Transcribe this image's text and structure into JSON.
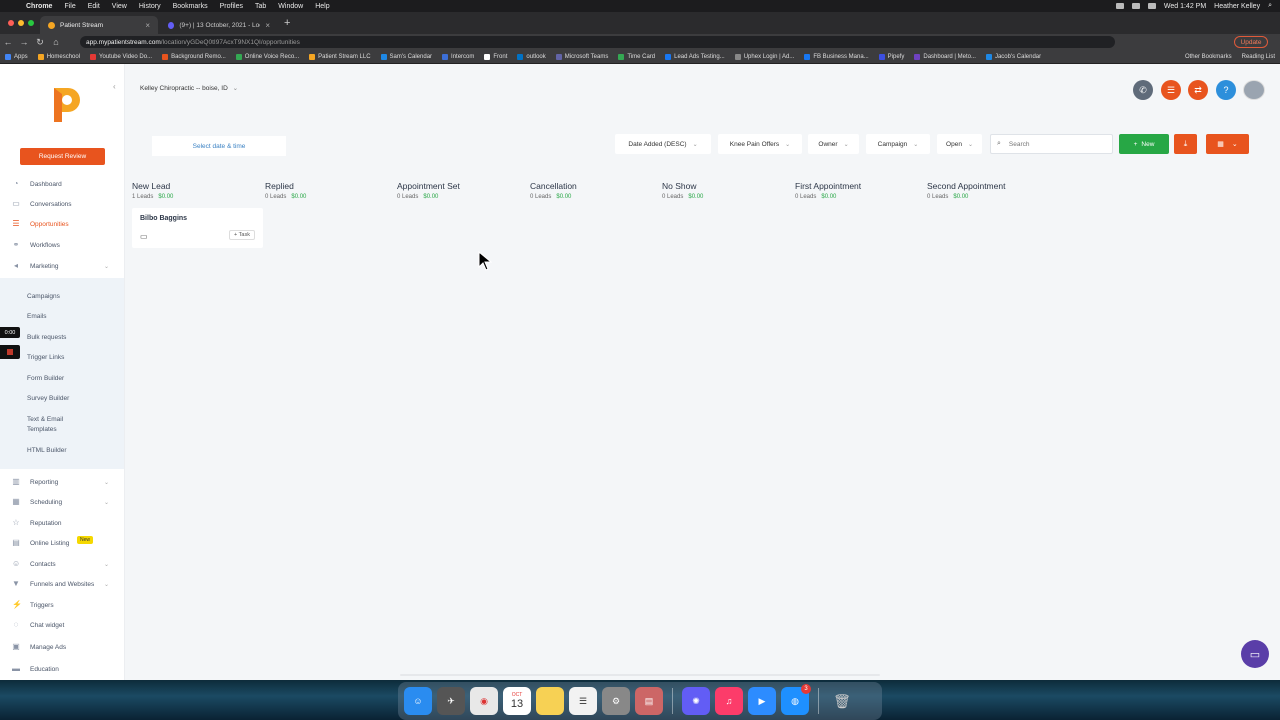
{
  "menubar": {
    "app": "Chrome",
    "items": [
      "File",
      "Edit",
      "View",
      "History",
      "Bookmarks",
      "Profiles",
      "Tab",
      "Window",
      "Help"
    ],
    "clock": "Wed 1:42 PM",
    "user": "Heather Kelley"
  },
  "browser": {
    "tabs": [
      {
        "title": "Patient Stream",
        "active": true
      },
      {
        "title": "(9+) | 13 October, 2021 - Loom",
        "active": false
      }
    ],
    "url_host": "app.mypatientstream.com",
    "url_path": "/location/yGDeQ0tI97AcxT9NX1QI/opportunities",
    "update_label": "Update",
    "bookmarks": [
      "Apps",
      "Homeschool",
      "Youtube Video Do...",
      "Background Remo...",
      "Online Voice Reco...",
      "Patient Stream LLC",
      "Sam's Calendar",
      "Intercom",
      "Front",
      "outlook",
      "Microsoft Teams",
      "Time Card",
      "Lead Ads Testing...",
      "Uphex Login | Ad...",
      "FB Business Mana...",
      "Pipefy",
      "Dashboard | Meto...",
      "Jacob's Calendar"
    ],
    "bookmarks_right": [
      "Other Bookmarks",
      "Reading List"
    ]
  },
  "sidebar": {
    "request_review": "Request Review",
    "items": [
      {
        "label": "Dashboard",
        "icon": "dashboard-icon"
      },
      {
        "label": "Conversations",
        "icon": "chat-icon"
      },
      {
        "label": "Opportunities",
        "icon": "funnel-icon",
        "active": true
      },
      {
        "label": "Workflows",
        "icon": "workflow-icon"
      },
      {
        "label": "Marketing",
        "icon": "megaphone-icon"
      }
    ],
    "marketing_sub": [
      "Campaigns",
      "Emails",
      "Bulk requests",
      "Trigger Links",
      "Form Builder",
      "Survey Builder",
      "Text & Email Templates",
      "HTML Builder"
    ],
    "items_bottom": [
      {
        "label": "Reporting",
        "icon": "chart-icon"
      },
      {
        "label": "Scheduling",
        "icon": "calendar-icon"
      },
      {
        "label": "Reputation",
        "icon": "star-icon"
      },
      {
        "label": "Online Listing",
        "icon": "listing-icon"
      },
      {
        "label": "Contacts",
        "icon": "user-icon"
      },
      {
        "label": "Funnels and Websites",
        "icon": "filter-icon"
      },
      {
        "label": "Triggers",
        "icon": "trigger-icon"
      },
      {
        "label": "Chat widget",
        "icon": "chat-widget-icon"
      },
      {
        "label": "Manage Ads",
        "icon": "ads-icon"
      },
      {
        "label": "Education",
        "icon": "education-icon"
      }
    ],
    "new_badge": "New",
    "timer": "0:00"
  },
  "header": {
    "location": "Kelley Chiropractic -- boise, ID"
  },
  "filters": {
    "date_picker": "Select date & time",
    "sort": "Date Added (DESC)",
    "pipeline": "Knee Pain Offers",
    "owner": "Owner",
    "campaign": "Campaign",
    "status": "Open",
    "search_placeholder": "Search",
    "new_label": "New"
  },
  "stages": [
    {
      "name": "New Lead",
      "leads": "1 Leads",
      "amount": "$0.00"
    },
    {
      "name": "Replied",
      "leads": "0 Leads",
      "amount": "$0.00"
    },
    {
      "name": "Appointment Set",
      "leads": "0 Leads",
      "amount": "$0.00"
    },
    {
      "name": "Cancellation",
      "leads": "0 Leads",
      "amount": "$0.00"
    },
    {
      "name": "No Show",
      "leads": "0 Leads",
      "amount": "$0.00"
    },
    {
      "name": "First Appointment",
      "leads": "0 Leads",
      "amount": "$0.00"
    },
    {
      "name": "Second Appointment",
      "leads": "0 Leads",
      "amount": "$0.00"
    }
  ],
  "lead_card": {
    "name": "Bilbo Baggins",
    "task_label": "+ Task"
  },
  "dock": {
    "calendar_day": "13",
    "calendar_month": "OCT",
    "messages_badge": "3"
  },
  "colors": {
    "brand": "#e8541e",
    "success": "#27a745",
    "link": "#3b82c4"
  }
}
